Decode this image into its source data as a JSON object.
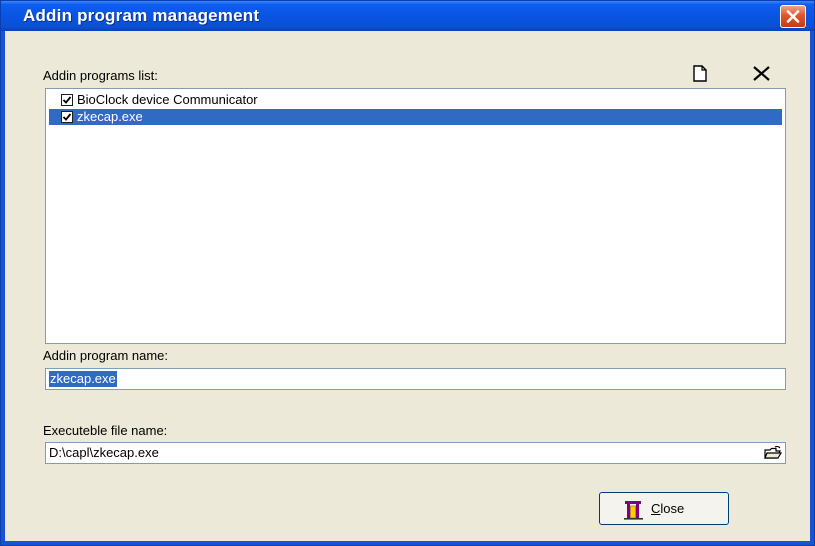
{
  "window": {
    "title": "Addin program management"
  },
  "list": {
    "label": "Addin programs list:",
    "items": [
      {
        "label": "BioClock device Communicator",
        "checked": true,
        "selected": false
      },
      {
        "label": "zkecap.exe",
        "checked": true,
        "selected": true
      }
    ]
  },
  "name_field": {
    "label": "Addin program name:",
    "value": "zkecap.exe"
  },
  "exe_field": {
    "label": "Executeble file name:",
    "value": "D:\\capl\\zkecap.exe"
  },
  "close_button": {
    "label_mnemonic": "C",
    "label_rest": "lose"
  },
  "icons": {
    "new": "new-document-icon",
    "delete": "delete-x-icon",
    "browse": "open-folder-icon",
    "close_btn": "door-exit-icon",
    "title_close": "close-icon"
  },
  "colors": {
    "title_bar": "#0a54e0",
    "selection": "#316ac5",
    "client_bg": "#ece9d8",
    "close_red": "#e2542c"
  }
}
